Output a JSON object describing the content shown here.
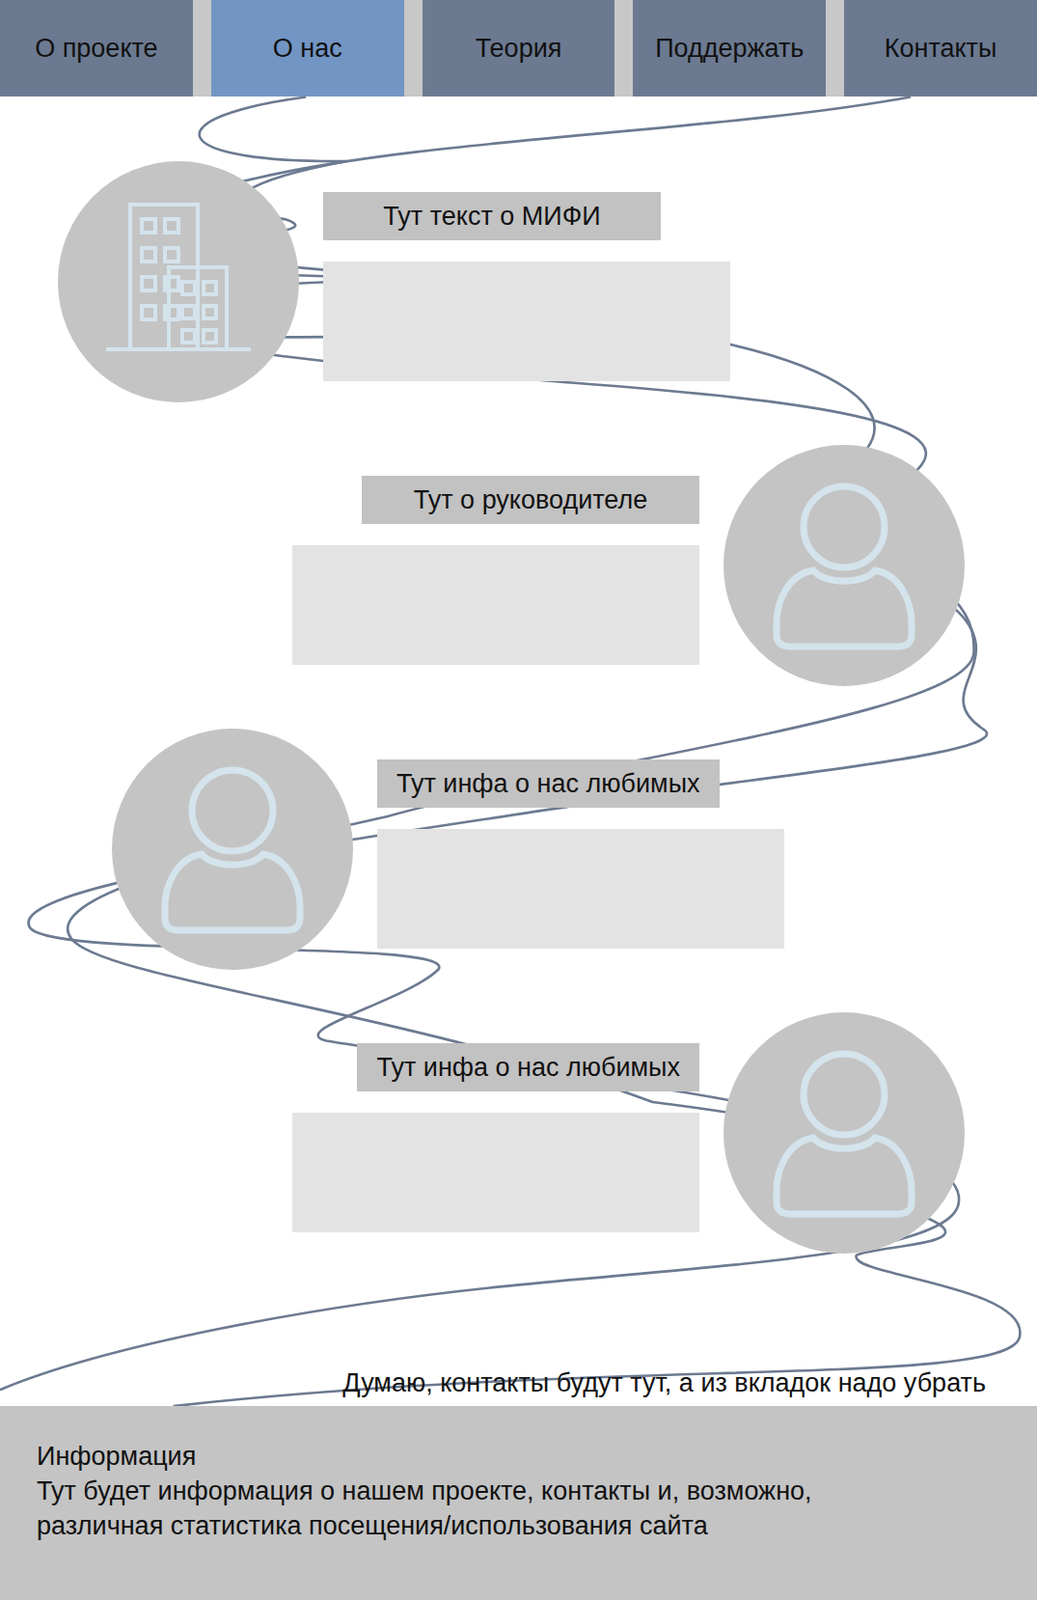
{
  "tabs": [
    {
      "label": "О проекте",
      "selected": false
    },
    {
      "label": "О нас",
      "selected": true
    },
    {
      "label": "Теория",
      "selected": false
    },
    {
      "label": "Поддержать",
      "selected": false
    },
    {
      "label": "Контакты",
      "selected": false
    }
  ],
  "sections": [
    {
      "title": "Тут текст о МИФИ",
      "kind": "building"
    },
    {
      "title": "Тут о руководителе",
      "kind": "person"
    },
    {
      "title": "Тут инфа о нас любимых",
      "kind": "person"
    },
    {
      "title": "Тут инфа о нас любимых",
      "kind": "person"
    }
  ],
  "note": "Думаю, контакты будут тут, а из вкладок надо убрать",
  "footer": {
    "title": "Информация",
    "lines": [
      "Тут будет информация о нашем проекте, контакты и, возможно,",
      "различная статистика посещения/использования сайта"
    ]
  }
}
